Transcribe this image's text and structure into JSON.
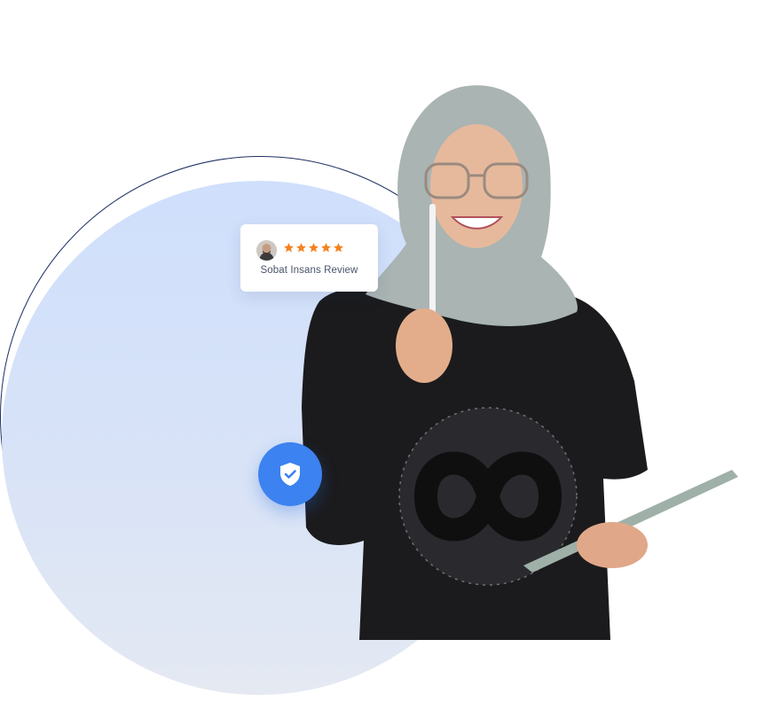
{
  "review": {
    "label": "Sobat Insans Review",
    "rating": 5,
    "max_rating": 5,
    "star_color": "#f5821f"
  },
  "badge": {
    "icon": "shield-check-icon",
    "color": "#3c82f0"
  },
  "colors": {
    "circle_fill": "#cfdffc",
    "circle_outline": "#1f2f63"
  }
}
